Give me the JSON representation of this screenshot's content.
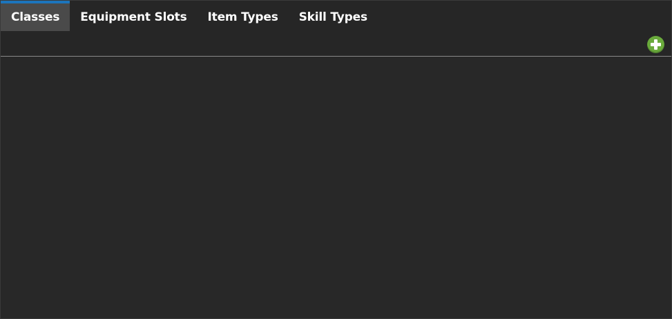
{
  "tabs": [
    {
      "label": "Classes",
      "active": true
    },
    {
      "label": "Equipment Slots",
      "active": false
    },
    {
      "label": "Item Types",
      "active": false
    },
    {
      "label": "Skill Types",
      "active": false
    }
  ],
  "toolbar": {
    "add_icon": "plus-circle-icon"
  },
  "colors": {
    "accent": "#1c75bc",
    "add_button": "#6aaa3c",
    "active_tab_bg": "#4a4a4a",
    "background": "#262626"
  }
}
